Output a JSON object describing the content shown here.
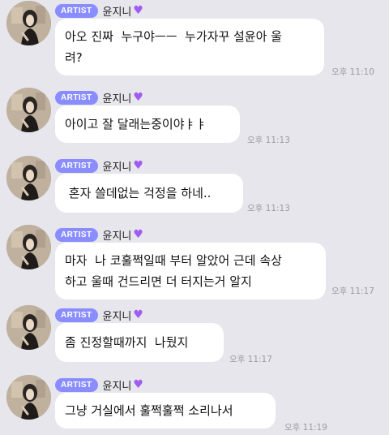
{
  "artist_badge": "ARTIST",
  "sender_name": "윤지니",
  "heart_icon": "purple-heart",
  "colors": {
    "background": "#e6e6ec",
    "bubble": "#ffffff",
    "badge": "#8a8dff",
    "heart": "#a05cf0",
    "time": "#9a9aa0"
  },
  "messages": [
    {
      "lines": [
        "아오 진짜  누구야ㅡㅡ  누가자꾸 설윤아 울",
        "려?"
      ],
      "time": "오후 11:10"
    },
    {
      "lines": [
        "아이고 잘 달래는중이야ㅑㅑ"
      ],
      "time": "오후 11:13"
    },
    {
      "lines": [
        " 혼자 쓸데없는 걱정을 하네.."
      ],
      "time": "오후 11:13"
    },
    {
      "lines": [
        "마자  나 코훌쩍일때 부터 알았어 근데 속상",
        "하고 울때 건드리면 더 터지는거 알지"
      ],
      "time": "오후 11:17"
    },
    {
      "lines": [
        "좀 진정할때까지  나뒀지"
      ],
      "time": "오후 11:17"
    },
    {
      "lines": [
        "그냥 거실에서 훌쩍훌쩍 소리나서"
      ],
      "time": "오후 11:19"
    }
  ]
}
